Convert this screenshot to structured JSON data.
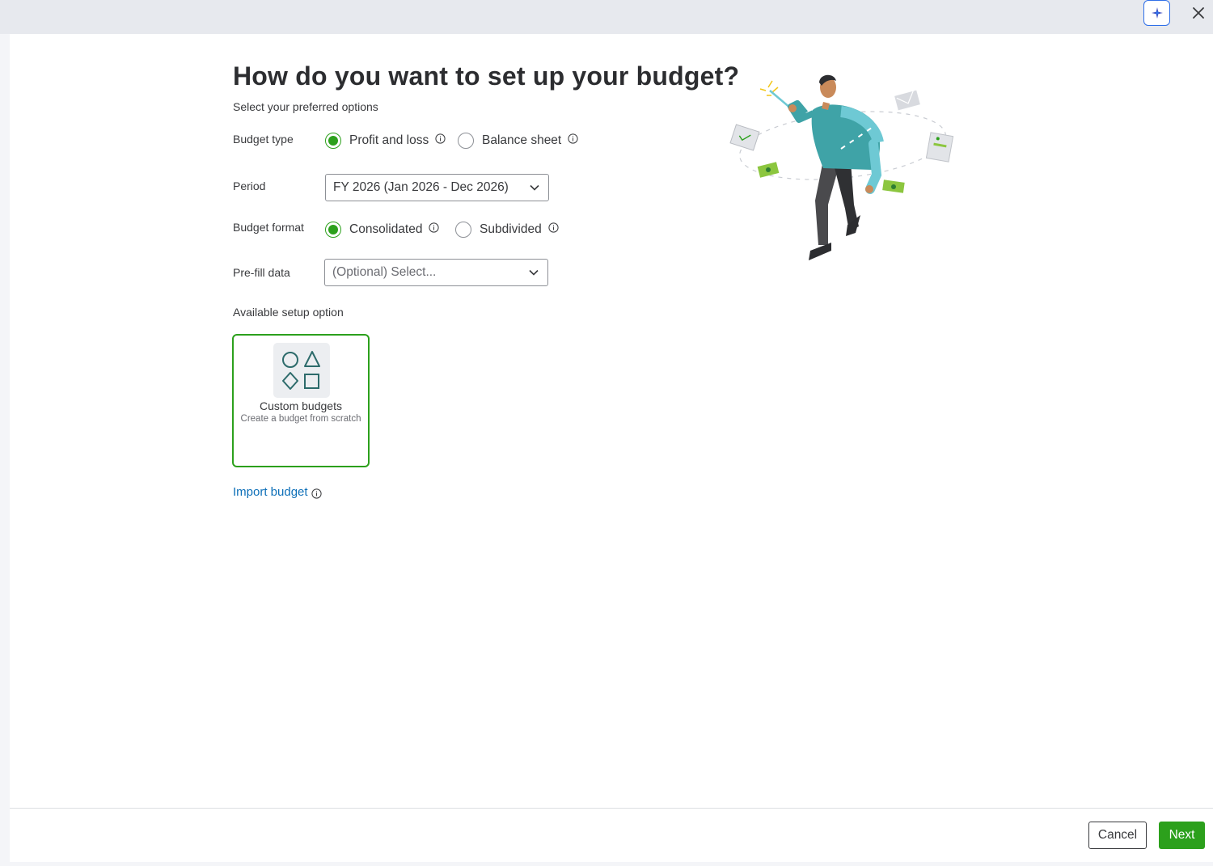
{
  "page": {
    "title": "How do you want to set up your budget?",
    "subtitle": "Select your preferred options"
  },
  "budget_type": {
    "label": "Budget type",
    "options": [
      {
        "label": "Profit and loss",
        "selected": true
      },
      {
        "label": "Balance sheet",
        "selected": false
      }
    ]
  },
  "period": {
    "label": "Period",
    "value": "FY 2026 (Jan 2026 - Dec 2026)"
  },
  "budget_format": {
    "label": "Budget format",
    "options": [
      {
        "label": "Consolidated",
        "selected": true
      },
      {
        "label": "Subdivided",
        "selected": false
      }
    ]
  },
  "prefill": {
    "label": "Pre-fill data",
    "placeholder": "(Optional) Select..."
  },
  "setup": {
    "label": "Available setup option",
    "card_title": "Custom budgets",
    "card_desc": "Create a budget from scratch"
  },
  "import": {
    "label": "Import budget"
  },
  "footer": {
    "cancel": "Cancel",
    "next": "Next"
  },
  "icons": {
    "assistant": "sparkle-icon",
    "close": "close-icon",
    "info": "info-icon",
    "chevron": "chevron-down-icon",
    "shapes": "shapes-icon"
  },
  "colors": {
    "accent_green": "#2ca01c",
    "link_blue": "#0d6fb8",
    "assistant_border": "#2f6fe8",
    "text": "#393a3d"
  }
}
